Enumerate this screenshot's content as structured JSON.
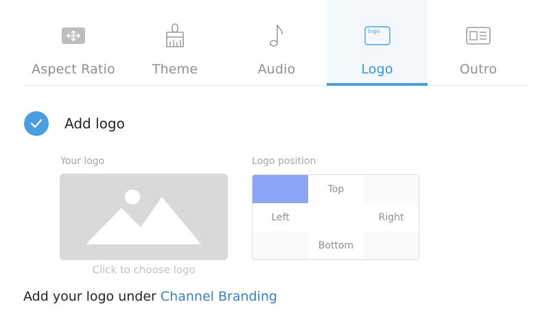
{
  "tabs": {
    "items": [
      {
        "label": "Aspect Ratio",
        "icon": "aspect-ratio-icon"
      },
      {
        "label": "Theme",
        "icon": "paintbrush-icon"
      },
      {
        "label": "Audio",
        "icon": "music-note-icon"
      },
      {
        "label": "Logo",
        "icon": "logo-icon",
        "icon_text": "logo"
      },
      {
        "label": "Outro",
        "icon": "outro-card-icon"
      }
    ],
    "active": "Logo"
  },
  "add_logo": {
    "label": "Add logo",
    "checked": true
  },
  "your_logo": {
    "label": "Your logo",
    "choose_text": "Click to choose logo",
    "placeholder_icon": "image-placeholder-icon"
  },
  "logo_position": {
    "label": "Logo position",
    "cells": [
      "",
      "Top",
      "",
      "Left",
      "",
      "Right",
      "",
      "Bottom",
      ""
    ],
    "selected": "top-left"
  },
  "footer": {
    "prefix": "Add your logo under ",
    "link": "Channel Branding"
  },
  "colors": {
    "accent": "#4a9ee0",
    "active_tab_bg": "#f3f8fd",
    "selected_position": "#8ba5f4",
    "link": "#3f7fb8"
  }
}
